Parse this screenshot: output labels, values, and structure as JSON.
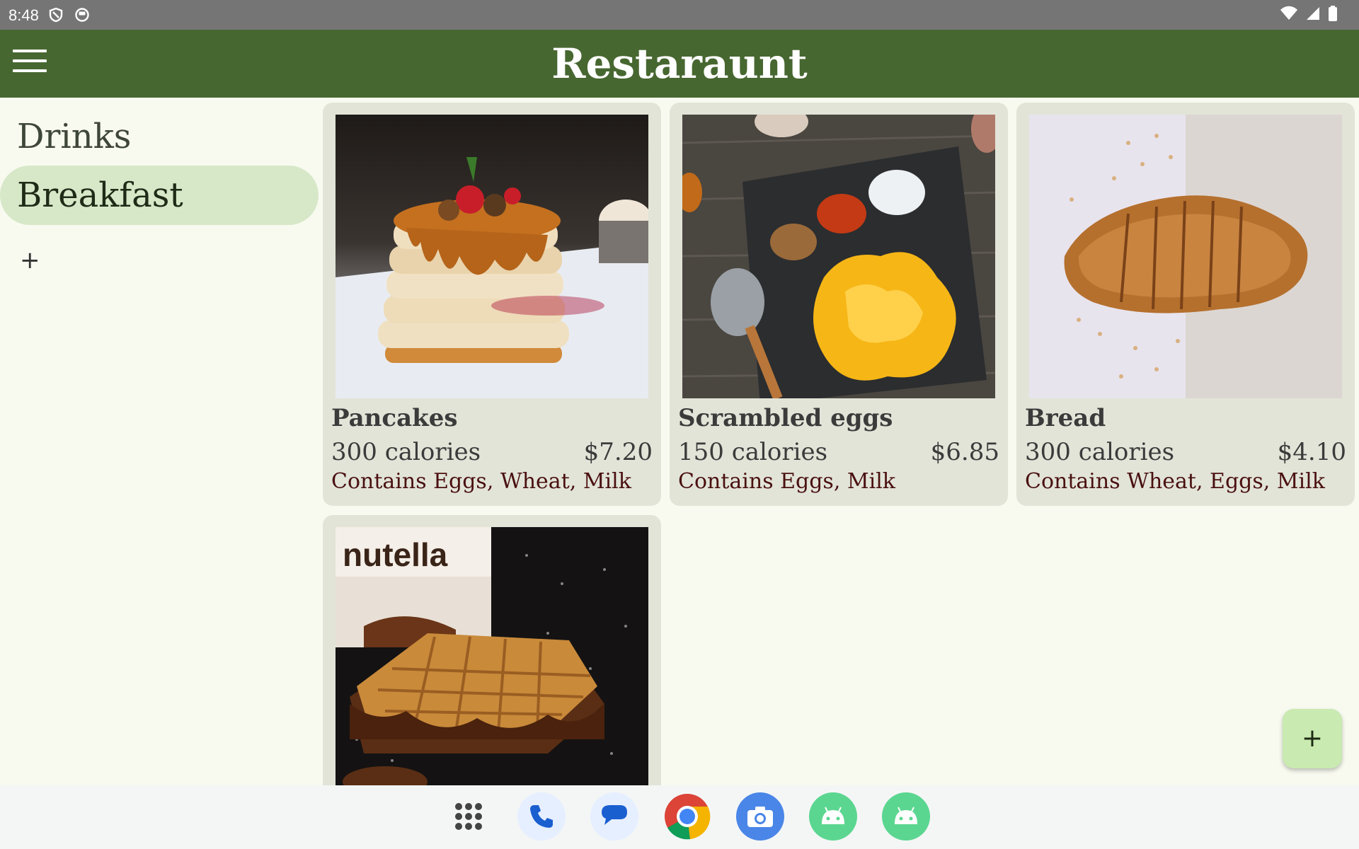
{
  "status_bar": {
    "time": "8:48"
  },
  "app_bar": {
    "title": "Restaraunt"
  },
  "nav": {
    "items": [
      {
        "label": "Drinks"
      },
      {
        "label": "Breakfast"
      }
    ],
    "add_label": "+"
  },
  "menu_items": [
    {
      "name": "Pancakes",
      "calories": "300 calories",
      "price": "$7.20",
      "allergens": "Contains Eggs, Wheat, Milk"
    },
    {
      "name": "Scrambled eggs",
      "calories": "150 calories",
      "price": "$6.85",
      "allergens": "Contains Eggs, Milk"
    },
    {
      "name": "Bread",
      "calories": "300 calories",
      "price": "$4.10",
      "allergens": "Contains Wheat, Eggs, Milk"
    },
    {
      "name": "",
      "image_label": "nutella"
    }
  ],
  "fab": {
    "label": "+"
  },
  "dock": [
    "apps-grid-icon",
    "phone-icon",
    "messages-icon",
    "chrome-icon",
    "camera-icon",
    "android-icon",
    "android-icon"
  ],
  "colors": {
    "app_bar": "#476730",
    "nav_active": "#d7e8c8",
    "card": "#e2e4d8",
    "fab": "#c9eab0",
    "allergen_text": "#4a1010"
  }
}
